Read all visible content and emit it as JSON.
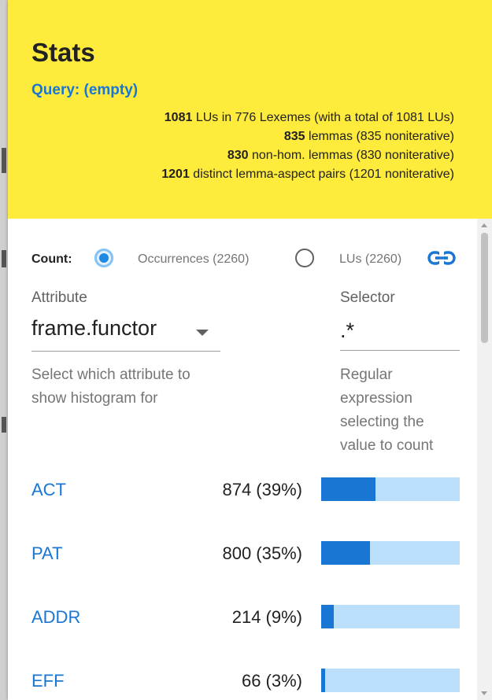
{
  "stats": {
    "title": "Stats",
    "query": "Query: (empty)",
    "summary": [
      {
        "count": "1081",
        "text": " LUs in 776 Lexemes (with a total of 1081 LUs)"
      },
      {
        "count": "835",
        "text": " lemmas (835 noniterative)"
      },
      {
        "count": "830",
        "text": " non-hom. lemmas (830 noniterative)"
      },
      {
        "count": "1201",
        "text": " distinct lemma-aspect pairs (1201 noniterative)"
      }
    ]
  },
  "count": {
    "label": "Count:",
    "options": [
      {
        "label": "Occurrences (2260)",
        "selected": true
      },
      {
        "label": "LUs (2260)",
        "selected": false
      }
    ],
    "link_icon": "link-icon"
  },
  "attribute": {
    "label": "Attribute",
    "value": "frame.functor",
    "hint": "Select which attribute to show histogram for"
  },
  "selector": {
    "label": "Selector",
    "value": ".*",
    "hint": "Regular expression selecting the value to count"
  },
  "histogram": [
    {
      "name": "ACT",
      "value": "874 (39%)",
      "fraction": 0.39
    },
    {
      "name": "PAT",
      "value": "800 (35%)",
      "fraction": 0.35
    },
    {
      "name": "ADDR",
      "value": "214 (9%)",
      "fraction": 0.09
    },
    {
      "name": "EFF",
      "value": "66 (3%)",
      "fraction": 0.03
    }
  ],
  "colors": {
    "header": "#ffeb3b",
    "accent": "#1976d2",
    "bar_track": "#bbdefb"
  }
}
